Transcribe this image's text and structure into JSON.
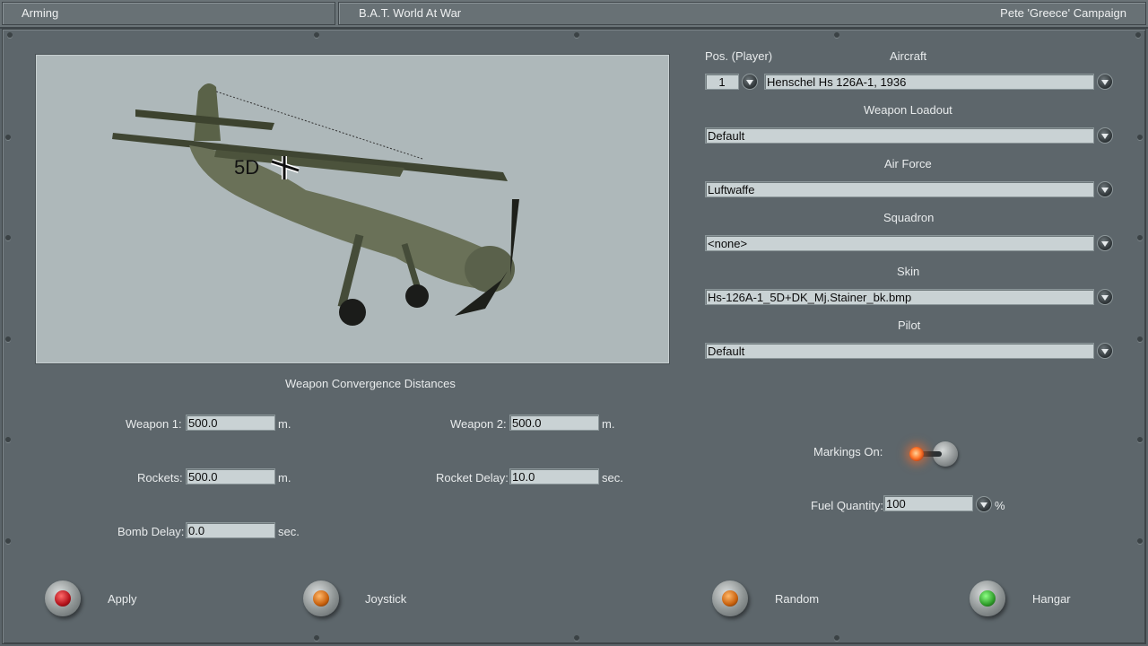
{
  "titlebar": {
    "screen": "Arming",
    "game": "B.A.T. World At War",
    "campaign": "Pete 'Greece' Campaign"
  },
  "aircraft_view": {
    "image": "Henschel Hs 126 biplane model preview"
  },
  "convergence": {
    "heading": "Weapon Convergence Distances",
    "weapon1": {
      "label": "Weapon 1:",
      "value": "500.0",
      "unit": "m."
    },
    "weapon2": {
      "label": "Weapon 2:",
      "value": "500.0",
      "unit": "m."
    },
    "rockets": {
      "label": "Rockets:",
      "value": "500.0",
      "unit": "m."
    },
    "rocket_delay": {
      "label": "Rocket Delay:",
      "value": "10.0",
      "unit": "sec."
    },
    "bomb_delay": {
      "label": "Bomb Delay:",
      "value": "0.0",
      "unit": "sec."
    }
  },
  "config": {
    "pos_label": "Pos. (Player)",
    "pos_value": "1",
    "aircraft_label": "Aircraft",
    "aircraft_value": "Henschel Hs 126A-1, 1936",
    "loadout_label": "Weapon Loadout",
    "loadout_value": "Default",
    "airforce_label": "Air Force",
    "airforce_value": "Luftwaffe",
    "squadron_label": "Squadron",
    "squadron_value": "<none>",
    "skin_label": "Skin",
    "skin_value": "Hs-126A-1_5D+DK_Mj.Stainer_bk.bmp",
    "pilot_label": "Pilot",
    "pilot_value": "Default"
  },
  "options": {
    "markings_label": "Markings On:",
    "markings_on": true,
    "fuel_label": "Fuel Quantity:",
    "fuel_value": "100",
    "fuel_unit": "%"
  },
  "buttons": {
    "apply": "Apply",
    "joystick": "Joystick",
    "random": "Random",
    "hangar": "Hangar"
  },
  "colors": {
    "panel": "#5d666b",
    "field": "#c9d2d4",
    "apply_lamp": "#b3121b",
    "joystick_lamp": "#c8600c",
    "random_lamp": "#c8600c",
    "hangar_lamp": "#2f9c2a",
    "markings_lamp": "#ff7a2e"
  }
}
